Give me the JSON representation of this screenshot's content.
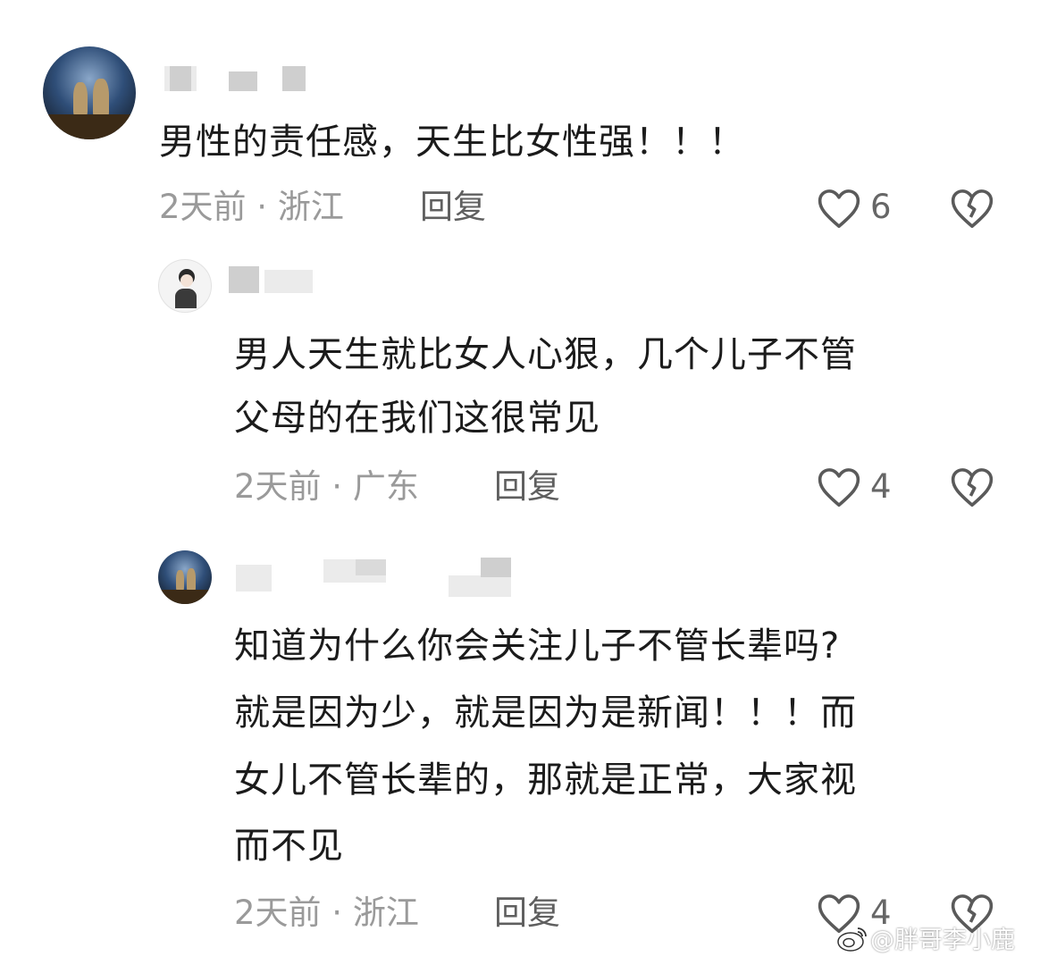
{
  "comments": [
    {
      "text": "男性的责任感，天生比女性强！！！",
      "meta": "2天前 · 浙江",
      "reply_label": "回复",
      "likes": "6"
    },
    {
      "text_lines": [
        "男人天生就比女人心狠，几个儿子不管",
        "父母的在我们这很常见"
      ],
      "meta": "2天前 · 广东",
      "reply_label": "回复",
      "likes": "4"
    },
    {
      "text_lines": [
        "知道为什么你会关注儿子不管长辈吗?",
        "就是因为少，就是因为是新闻！！！而",
        "女儿不管长辈的，那就是正常，大家视",
        "而不见"
      ],
      "meta": "2天前 · 浙江",
      "reply_label": "回复",
      "likes": "4"
    }
  ],
  "icons": {
    "like": "heart-outline-icon",
    "dislike": "broken-heart-icon",
    "watermark": "weibo-logo-icon"
  },
  "watermark": "@胖哥李小鹿",
  "colors": {
    "text": "#1b1b1b",
    "meta": "#9a9a9a",
    "icon": "#5a5a5a"
  }
}
